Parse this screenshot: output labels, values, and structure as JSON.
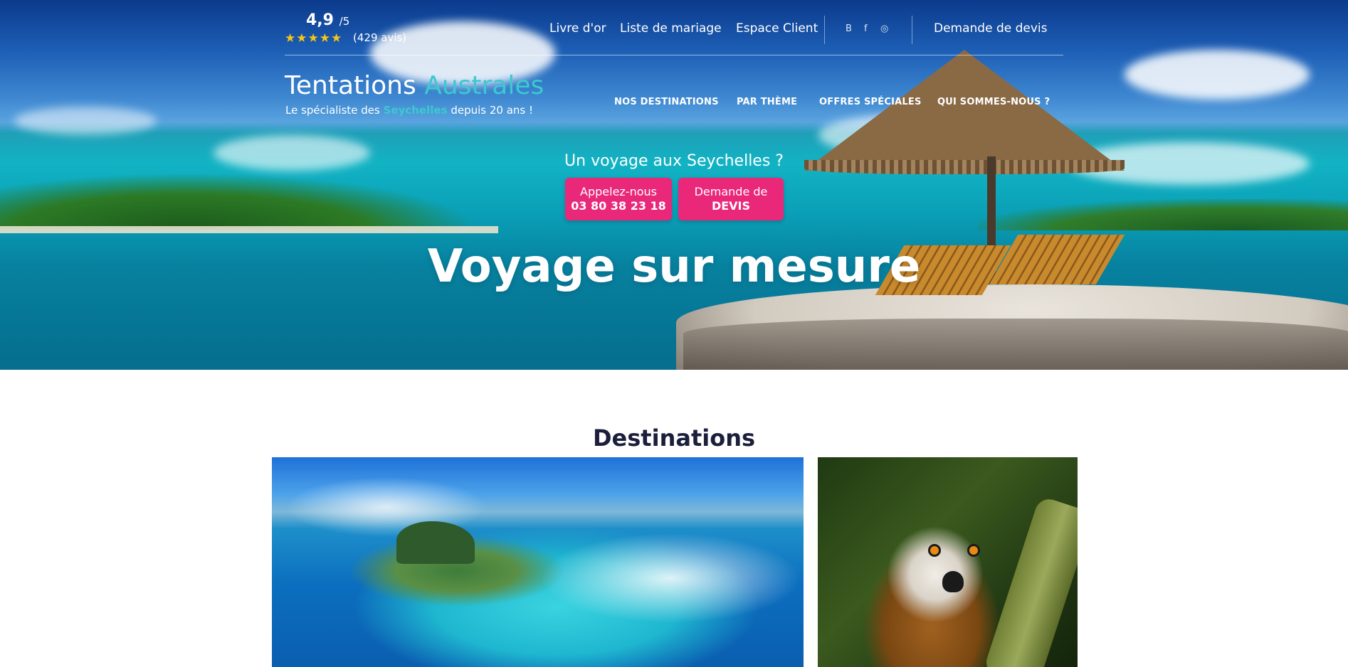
{
  "rating": {
    "score": "4,9",
    "scale": "/5",
    "stars": "★★★★★",
    "stars_value": 5,
    "reviews": "(429 avis)"
  },
  "top_links": {
    "guestbook": "Livre d'or",
    "wedding_list": "Liste de mariage",
    "client_area": "Espace Client",
    "quote_request": "Demande de devis"
  },
  "social": {
    "blog_icon": "B",
    "facebook_icon": "f",
    "instagram_icon": "◎"
  },
  "brand": {
    "name_part1": "Tentations",
    "name_part2": "Australes",
    "tagline_before": "Le spécialiste des",
    "tagline_accent": "Seychelles",
    "tagline_after": "depuis 20 ans !",
    "accent_color": "#3cc9cf"
  },
  "nav": {
    "destinations": "NOS DESTINATIONS",
    "by_theme": "PAR THÈME",
    "special_offers": "OFFRES SPÉCIALES",
    "about": "QUI SOMMES-NOUS ?"
  },
  "hero": {
    "question": "Un voyage aux Seychelles ?",
    "call_label": "Appelez-nous",
    "call_number": "03 80 38 23 18",
    "quote_label": "Demande de",
    "quote_strong": "DEVIS",
    "title": "Voyage sur mesure",
    "button_color": "#e9287a"
  },
  "destinations": {
    "title": "Destinations"
  }
}
